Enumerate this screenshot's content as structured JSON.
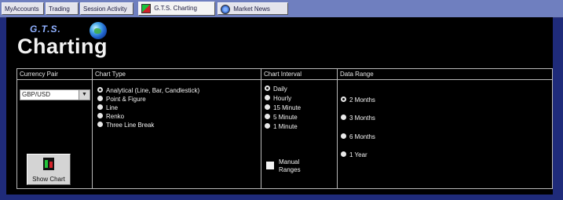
{
  "tabs": [
    {
      "label": "MyAccounts"
    },
    {
      "label": "Trading"
    },
    {
      "label": "Session Activity"
    },
    {
      "label": "G.T.S. Charting"
    },
    {
      "label": "Market News"
    }
  ],
  "logo": {
    "small": "G.T.S.",
    "big": "Charting"
  },
  "columns": {
    "currency": "Currency Pair",
    "chart_type": "Chart Type",
    "interval": "Chart Interval",
    "range": "Data Range"
  },
  "currency_select": {
    "value": "GBP/USD"
  },
  "chart_types": [
    {
      "label": "Analytical (Line, Bar, Candlestick)",
      "selected": true
    },
    {
      "label": "Point & Figure",
      "selected": false
    },
    {
      "label": "Line",
      "selected": false
    },
    {
      "label": "Renko",
      "selected": false
    },
    {
      "label": "Three Line Break",
      "selected": false
    }
  ],
  "intervals": [
    {
      "label": "Daily",
      "selected": true
    },
    {
      "label": "Hourly",
      "selected": false
    },
    {
      "label": "15 Minute",
      "selected": false
    },
    {
      "label": "5 Minute",
      "selected": false
    },
    {
      "label": "1 Minute",
      "selected": false
    }
  ],
  "manual_ranges": {
    "label_line1": "Manual",
    "label_line2": "Ranges",
    "checked": false
  },
  "ranges": [
    {
      "label": "2 Months",
      "selected": true
    },
    {
      "label": "3 Months",
      "selected": false
    },
    {
      "label": "6 Months",
      "selected": false
    },
    {
      "label": "1 Year",
      "selected": false
    }
  ],
  "show_chart_button": {
    "label": "Show Chart"
  },
  "colors": {
    "background": "#1f2b7a",
    "panel": "#000000",
    "tab_bar": "#6f7fbf"
  }
}
